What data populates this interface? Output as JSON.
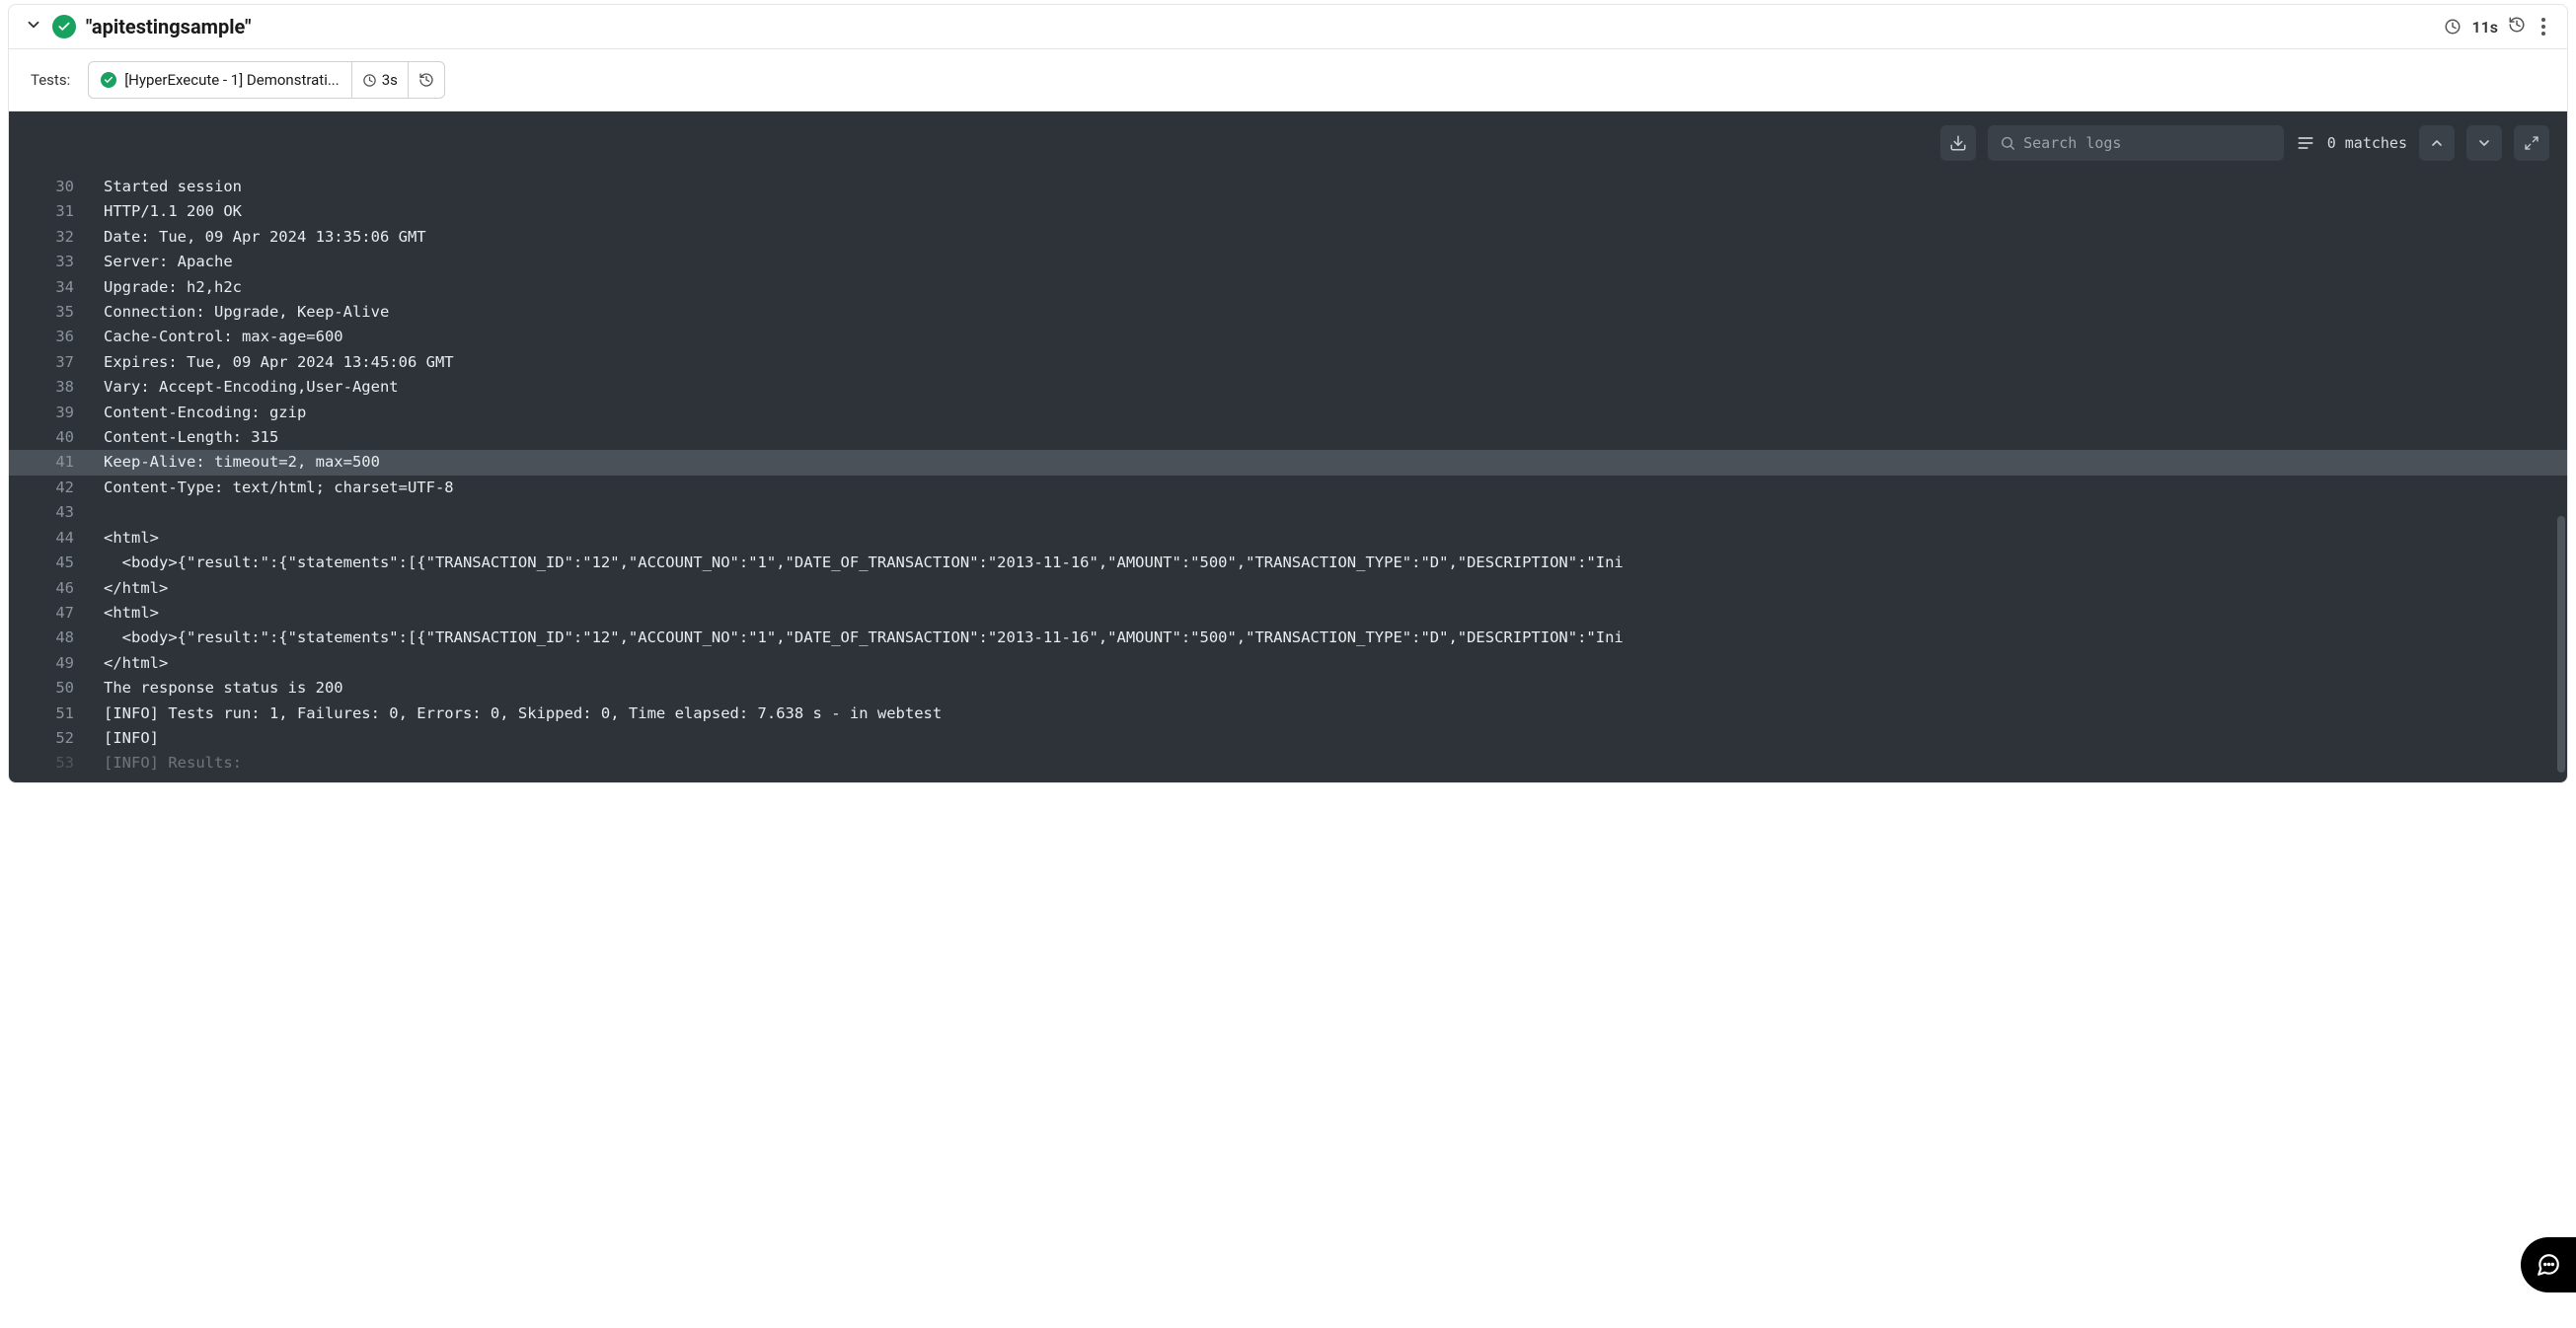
{
  "header": {
    "title": "\"apitestingsample\"",
    "duration": "11s"
  },
  "tests": {
    "label": "Tests:",
    "items": [
      {
        "title": "[HyperExecute - 1] Demonstrati...",
        "duration": "3s"
      }
    ]
  },
  "toolbar": {
    "search_placeholder": "Search logs",
    "matches": "0 matches"
  },
  "log": {
    "start": 30,
    "highlight": 41,
    "lines": [
      "Started session",
      "HTTP/1.1 200 OK",
      "Date: Tue, 09 Apr 2024 13:35:06 GMT",
      "Server: Apache",
      "Upgrade: h2,h2c",
      "Connection: Upgrade, Keep-Alive",
      "Cache-Control: max-age=600",
      "Expires: Tue, 09 Apr 2024 13:45:06 GMT",
      "Vary: Accept-Encoding,User-Agent",
      "Content-Encoding: gzip",
      "Content-Length: 315",
      "Keep-Alive: timeout=2, max=500",
      "Content-Type: text/html; charset=UTF-8",
      "",
      "<html>",
      "  <body>{\"result:\":{\"statements\":[{\"TRANSACTION_ID\":\"12\",\"ACCOUNT_NO\":\"1\",\"DATE_OF_TRANSACTION\":\"2013-11-16\",\"AMOUNT\":\"500\",\"TRANSACTION_TYPE\":\"D\",\"DESCRIPTION\":\"Ini",
      "</html>",
      "<html>",
      "  <body>{\"result:\":{\"statements\":[{\"TRANSACTION_ID\":\"12\",\"ACCOUNT_NO\":\"1\",\"DATE_OF_TRANSACTION\":\"2013-11-16\",\"AMOUNT\":\"500\",\"TRANSACTION_TYPE\":\"D\",\"DESCRIPTION\":\"Ini",
      "</html>",
      "The response status is 200",
      "[INFO] Tests run: 1, Failures: 0, Errors: 0, Skipped: 0, Time elapsed: 7.638 s - in webtest",
      "[INFO]",
      "[INFO] Results:"
    ]
  }
}
